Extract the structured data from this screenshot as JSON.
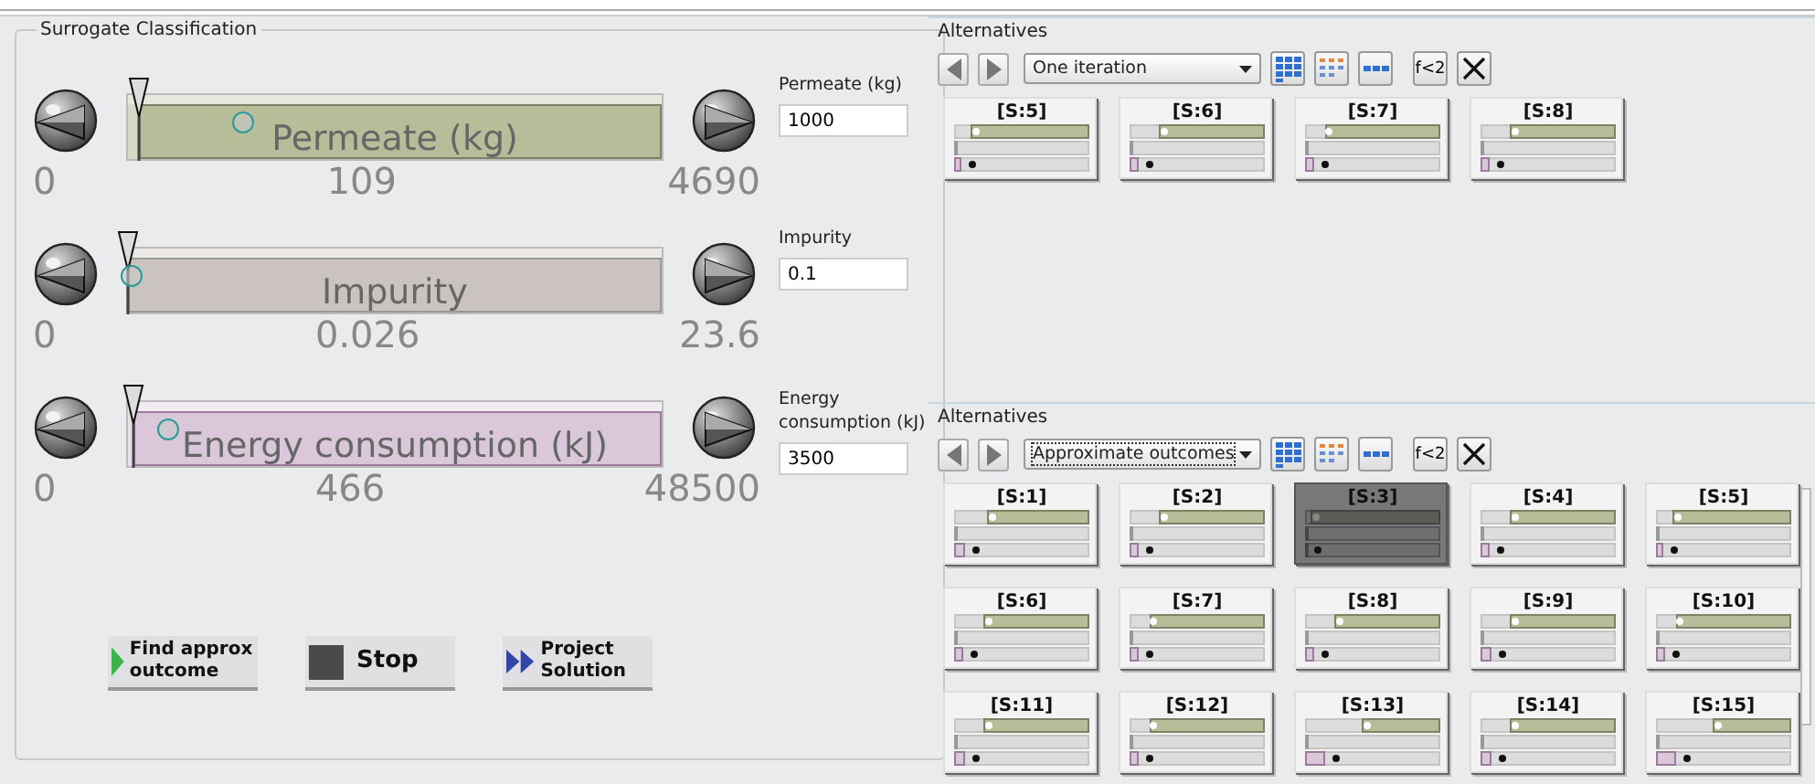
{
  "classification": {
    "title": "Surrogate Classification",
    "objectives": [
      {
        "name": "Permeate (kg)",
        "min": "0",
        "value": "109",
        "max": "4690",
        "marker": {
          "level": 0.02
        },
        "point": {
          "level": 0.21
        },
        "field_label": "Permeate (kg)",
        "field_value": "1000"
      },
      {
        "name": "Impurity",
        "min": "0",
        "value": "0.026",
        "max": "23.6",
        "marker": {
          "level": 0.0
        },
        "point": {
          "level": 0.0
        },
        "field_label": "Impurity",
        "field_value": "0.1"
      },
      {
        "name": "Energy consumption (kJ)",
        "min": "0",
        "value": "466",
        "max": "48500",
        "marker": {
          "level": 0.01
        },
        "point": {
          "level": 0.07
        },
        "field_label": "Energy consumption (kJ)",
        "field_value": "3500"
      }
    ],
    "buttons": [
      {
        "kind": "find",
        "label": "Find approx outcome"
      },
      {
        "kind": "stop",
        "label": "Stop"
      },
      {
        "kind": "project",
        "label": "Project Solution"
      }
    ]
  },
  "alternatives_panels": [
    {
      "title": "Alternatives",
      "mode": "One iteration",
      "formula_button": "f<2",
      "tiles": [
        {
          "label": "[S:5]",
          "selected": false,
          "bars": [
            {
              "level": 0.9
            },
            {
              "level": 0.0
            },
            {
              "level": 0.05
            }
          ]
        },
        {
          "label": "[S:6]",
          "selected": false,
          "bars": [
            {
              "level": 0.8
            },
            {
              "level": 0.0
            },
            {
              "level": 0.07
            }
          ]
        },
        {
          "label": "[S:7]",
          "selected": false,
          "bars": [
            {
              "level": 0.88
            },
            {
              "level": 0.0
            },
            {
              "level": 0.07
            }
          ]
        },
        {
          "label": "[S:8]",
          "selected": false,
          "bars": [
            {
              "level": 0.8
            },
            {
              "level": 0.0
            },
            {
              "level": 0.07
            }
          ]
        }
      ]
    },
    {
      "title": "Alternatives",
      "mode": "Approximate outcomes",
      "formula_button": "f<2",
      "tiles": [
        {
          "label": "[S:1]",
          "selected": false,
          "bars": [
            {
              "level": 0.78
            },
            {
              "level": 0.0
            },
            {
              "level": 0.09
            }
          ]
        },
        {
          "label": "[S:2]",
          "selected": false,
          "bars": [
            {
              "level": 0.8
            },
            {
              "level": 0.0
            },
            {
              "level": 0.07
            }
          ]
        },
        {
          "label": "[S:3]",
          "selected": true,
          "bars": [
            {
              "level": 0.98
            },
            {
              "level": 0.0
            },
            {
              "level": 0.01
            }
          ]
        },
        {
          "label": "[S:4]",
          "selected": false,
          "bars": [
            {
              "level": 0.8
            },
            {
              "level": 0.0
            },
            {
              "level": 0.07
            }
          ]
        },
        {
          "label": "[S:5]",
          "selected": false,
          "bars": [
            {
              "level": 0.9
            },
            {
              "level": 0.0
            },
            {
              "level": 0.05
            }
          ]
        },
        {
          "label": "[S:6]",
          "selected": false,
          "bars": [
            {
              "level": 0.8
            },
            {
              "level": 0.0
            },
            {
              "level": 0.07
            }
          ]
        },
        {
          "label": "[S:7]",
          "selected": false,
          "bars": [
            {
              "level": 0.88
            },
            {
              "level": 0.0
            },
            {
              "level": 0.07
            }
          ]
        },
        {
          "label": "[S:8]",
          "selected": false,
          "bars": [
            {
              "level": 0.8
            },
            {
              "level": 0.0
            },
            {
              "level": 0.07
            }
          ]
        },
        {
          "label": "[S:9]",
          "selected": false,
          "bars": [
            {
              "level": 0.8
            },
            {
              "level": 0.0
            },
            {
              "level": 0.09
            }
          ]
        },
        {
          "label": "[S:10]",
          "selected": false,
          "bars": [
            {
              "level": 0.88
            },
            {
              "level": 0.0
            },
            {
              "level": 0.07
            }
          ]
        },
        {
          "label": "[S:11]",
          "selected": false,
          "bars": [
            {
              "level": 0.8
            },
            {
              "level": 0.0
            },
            {
              "level": 0.08
            }
          ]
        },
        {
          "label": "[S:12]",
          "selected": false,
          "bars": [
            {
              "level": 0.88
            },
            {
              "level": 0.0
            },
            {
              "level": 0.07
            }
          ]
        },
        {
          "label": "[S:13]",
          "selected": false,
          "bars": [
            {
              "level": 0.6
            },
            {
              "level": 0.0
            },
            {
              "level": 0.15
            }
          ]
        },
        {
          "label": "[S:14]",
          "selected": false,
          "bars": [
            {
              "level": 0.8
            },
            {
              "level": 0.0
            },
            {
              "level": 0.09
            }
          ]
        },
        {
          "label": "[S:15]",
          "selected": false,
          "bars": [
            {
              "level": 0.6
            },
            {
              "level": 0.0
            },
            {
              "level": 0.15
            }
          ]
        }
      ]
    }
  ]
}
